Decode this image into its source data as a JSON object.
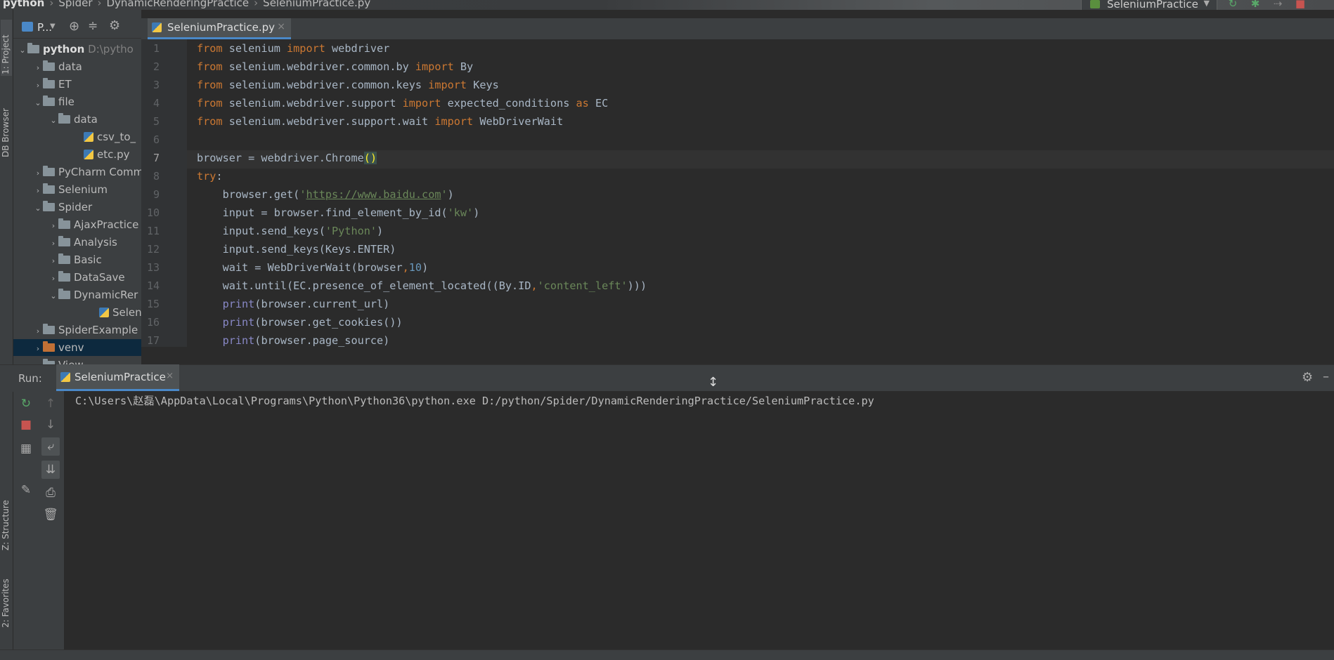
{
  "breadcrumb": [
    "python",
    "Spider",
    "DynamicRenderingPractice",
    "SeleniumPractice.py"
  ],
  "run_config": {
    "label": "SeleniumPractice"
  },
  "left_strip": {
    "project": "1: Project",
    "db_browser": "DB Browser",
    "structure": "Z: Structure",
    "favorites": "2: Favorites"
  },
  "project_panel": {
    "title": "P...",
    "tree": [
      {
        "label": "python",
        "extra": "D:\\pytho",
        "type": "folder",
        "expanded": true
      },
      {
        "label": "data",
        "type": "folder"
      },
      {
        "label": "ET",
        "type": "folder"
      },
      {
        "label": "file",
        "type": "folder",
        "expanded": true
      },
      {
        "label": "data",
        "type": "folder",
        "expanded": true
      },
      {
        "label": "csv_to_",
        "type": "file"
      },
      {
        "label": "etc.py",
        "type": "file"
      },
      {
        "label": "PyCharm Comm",
        "type": "folder"
      },
      {
        "label": "Selenium",
        "type": "folder"
      },
      {
        "label": "Spider",
        "type": "folder",
        "expanded": true
      },
      {
        "label": "AjaxPractice",
        "type": "folder"
      },
      {
        "label": "Analysis",
        "type": "folder"
      },
      {
        "label": "Basic",
        "type": "folder"
      },
      {
        "label": "DataSave",
        "type": "folder"
      },
      {
        "label": "DynamicRer",
        "type": "folder",
        "expanded": true
      },
      {
        "label": "Seleniun",
        "type": "file"
      },
      {
        "label": "SpiderExample",
        "type": "folder"
      },
      {
        "label": "venv",
        "type": "folder-orange"
      },
      {
        "label": "View",
        "type": "folder"
      }
    ]
  },
  "editor": {
    "tab_label": "SeleniumPractice.py",
    "line_numbers": [
      "1",
      "2",
      "3",
      "4",
      "5",
      "6",
      "7",
      "8",
      "9",
      "10",
      "11",
      "12",
      "13",
      "14",
      "15",
      "16",
      "17"
    ]
  },
  "run_panel": {
    "label": "Run:",
    "tab_label": "SeleniumPractice",
    "command": "C:\\Users\\赵磊\\AppData\\Local\\Programs\\Python\\Python36\\python.exe D:/python/Spider/DynamicRenderingPractice/SeleniumPractice.py"
  }
}
